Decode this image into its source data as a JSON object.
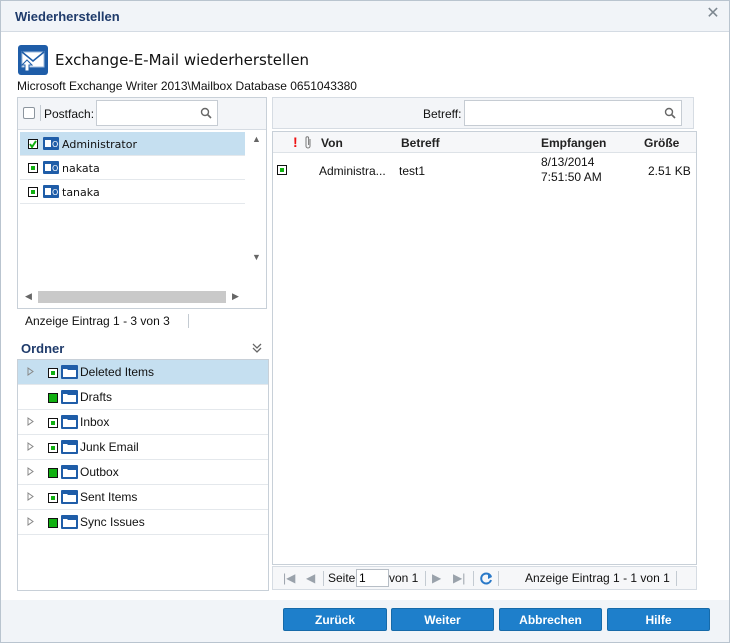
{
  "dialog": {
    "title": "Wiederherstellen"
  },
  "header": {
    "title": "Exchange-E-Mail wiederherstellen",
    "path": "Microsoft Exchange Writer 2013\\Mailbox Database 0651043380"
  },
  "mailbox_panel": {
    "filter_label": "Postfach:",
    "filter_value": "",
    "items": [
      {
        "label": "Administrator",
        "status": "checked",
        "selected": true
      },
      {
        "label": "nakata",
        "status": "partial",
        "selected": false
      },
      {
        "label": "tanaka",
        "status": "partial",
        "selected": false
      }
    ],
    "status": "Anzeige Eintrag 1 - 3 von 3"
  },
  "folders": {
    "heading": "Ordner",
    "items": [
      {
        "label": "Deleted Items",
        "status": "partial",
        "expandable": true,
        "selected": true
      },
      {
        "label": "Drafts",
        "status": "full",
        "expandable": false,
        "selected": false
      },
      {
        "label": "Inbox",
        "status": "partial",
        "expandable": true,
        "selected": false
      },
      {
        "label": "Junk Email",
        "status": "partial",
        "expandable": true,
        "selected": false
      },
      {
        "label": "Outbox",
        "status": "full",
        "expandable": true,
        "selected": false
      },
      {
        "label": "Sent Items",
        "status": "partial",
        "expandable": true,
        "selected": false
      },
      {
        "label": "Sync Issues",
        "status": "full",
        "expandable": true,
        "selected": false
      }
    ]
  },
  "mail_panel": {
    "filter_label": "Betreff:",
    "filter_value": "",
    "columns": {
      "importance": "!",
      "from": "Von",
      "subject": "Betreff",
      "received": "Empfangen",
      "size": "Größe"
    },
    "rows": [
      {
        "status": "partial",
        "from": "Administra...",
        "subject": "test1",
        "received_date": "8/13/2014",
        "received_time": "7:51:50 AM",
        "size": "2.51 KB"
      }
    ],
    "pager": {
      "page_label": "Seite",
      "page_value": "1",
      "of_label": "von 1",
      "status": "Anzeige Eintrag 1 - 1 von 1"
    }
  },
  "buttons": {
    "back": "Zurück",
    "next": "Weiter",
    "cancel": "Abbrechen",
    "help": "Hilfe"
  },
  "colors": {
    "accent": "#1e7fcb",
    "selection": "#c5dff0",
    "status_green": "#11b011",
    "title": "#1f3b6b"
  }
}
